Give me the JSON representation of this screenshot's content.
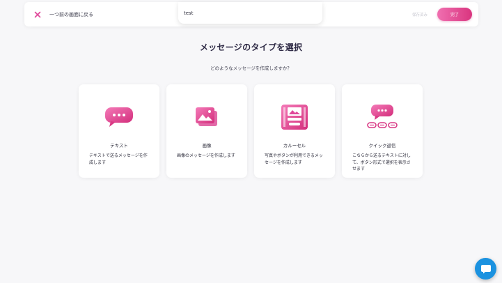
{
  "header": {
    "back_label": "一つ前の画面に戻る",
    "name_value": "test",
    "status": "保存済み",
    "done_label": "完了"
  },
  "main": {
    "title": "メッセージのタイプを選択",
    "subtitle": "どのようなメッセージを作成しますか？"
  },
  "cards": [
    {
      "icon": "chat-bubble-icon",
      "title": "テキスト",
      "desc": "テキストで送るメッセージを作成します"
    },
    {
      "icon": "image-icon",
      "title": "画像",
      "desc": "画像のメッセージを作成します"
    },
    {
      "icon": "carousel-icon",
      "title": "カルーセル",
      "desc": "写真やボタンが利用できるメッセージを作成します"
    },
    {
      "icon": "quick-reply-icon",
      "title": "クイック返信",
      "desc": "こちらから送るテキストに対して、ボタン形式で選択を表示させます"
    }
  ],
  "colors": {
    "accent": "#e03a8c",
    "fab": "#1b92e0"
  }
}
